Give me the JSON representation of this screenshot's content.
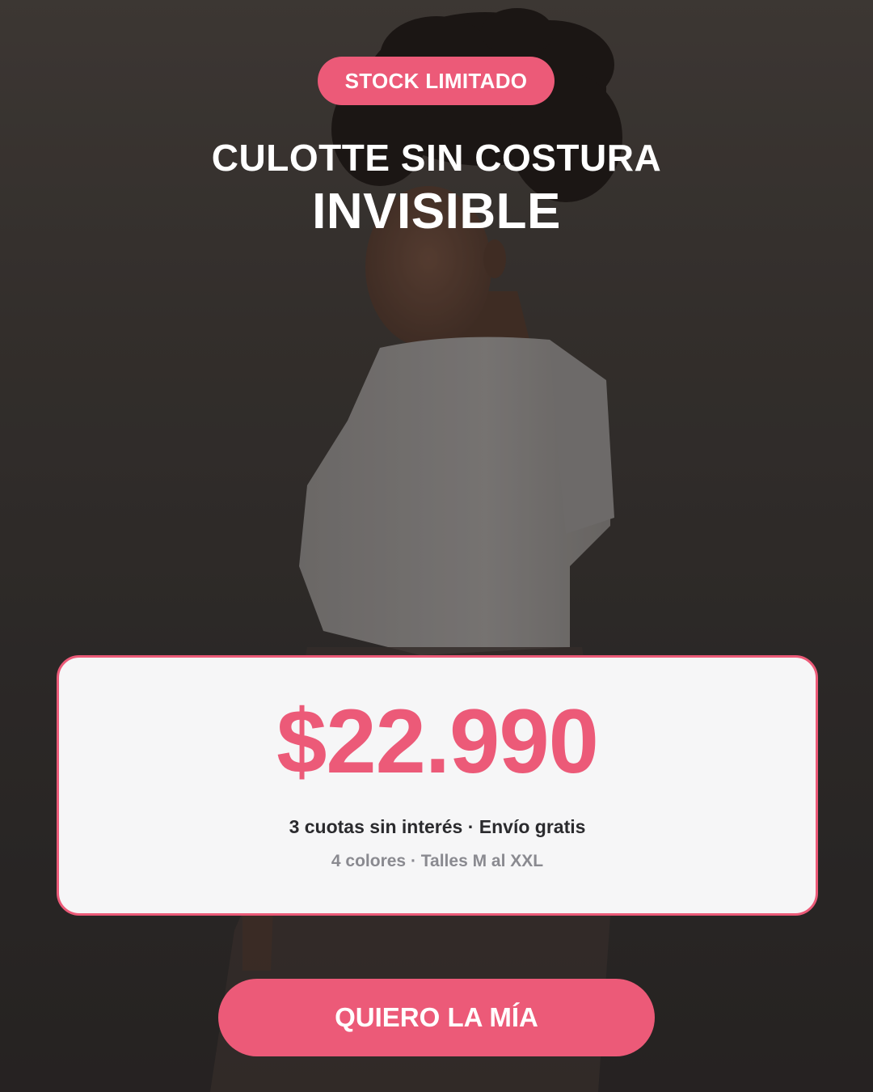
{
  "colors": {
    "accent": "#ec5a78",
    "background_top": "#4a443f",
    "background_bottom": "#2b2827",
    "card_background": "#f6f6f7",
    "title_text": "#ffffff"
  },
  "badge": {
    "label": "STOCK LIMITADO"
  },
  "headline": {
    "line1": "CULOTTE SIN COSTURA",
    "line2": "INVISIBLE"
  },
  "price_card": {
    "price": "$22.990",
    "terms": "3 cuotas sin interés · Envío gratis",
    "details": "4 colores · Talles M al XXL"
  },
  "cta": {
    "label": "QUIERO LA MÍA"
  }
}
